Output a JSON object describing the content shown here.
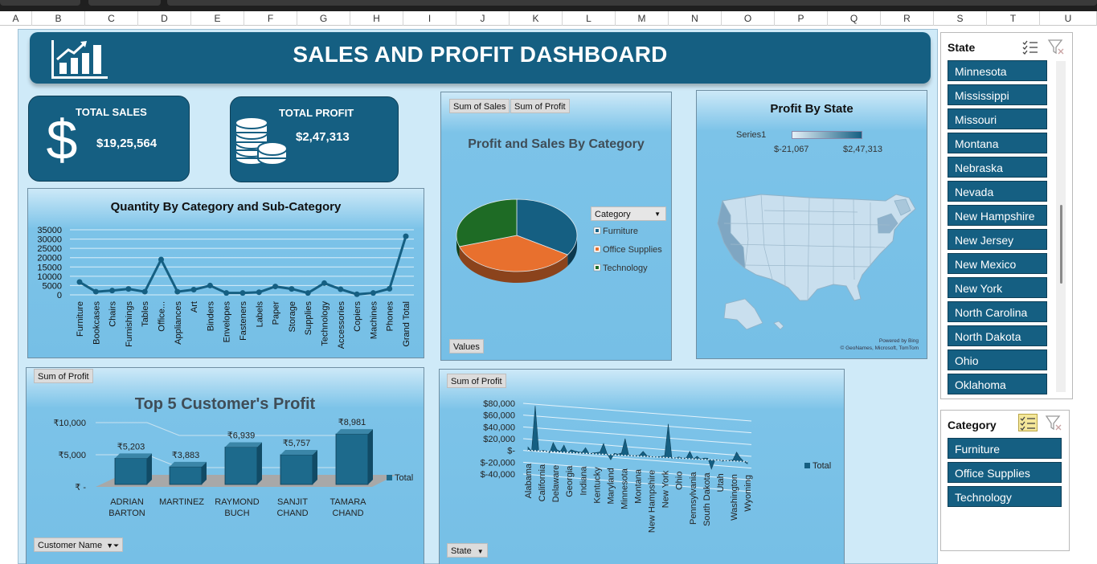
{
  "columns": [
    "A",
    "B",
    "C",
    "D",
    "E",
    "F",
    "G",
    "H",
    "I",
    "J",
    "K",
    "L",
    "M",
    "N",
    "O",
    "P",
    "Q",
    "R",
    "S",
    "T",
    "U"
  ],
  "dashboard": {
    "title": "SALES AND PROFIT DASHBOARD"
  },
  "kpis": {
    "sales": {
      "label": "TOTAL SALES",
      "value": "$19,25,564"
    },
    "profit": {
      "label": "TOTAL PROFIT",
      "value": "$2,47,313"
    }
  },
  "colors": {
    "brand": "#155f82",
    "panel": "#76bfe6",
    "orange": "#e8702e",
    "green": "#1e6b25",
    "line": "#155f82"
  },
  "chart_data": [
    {
      "id": "quantity",
      "type": "line",
      "title": "Quantity By Category and Sub-Category",
      "categories": [
        "Furniture",
        "Bookcases",
        "Chairs",
        "Furnishings",
        "Tables",
        "Office...",
        "Appliances",
        "Art",
        "Binders",
        "Envelopes",
        "Fasteners",
        "Labels",
        "Paper",
        "Storage",
        "Supplies",
        "Technology",
        "Accessories",
        "Copiers",
        "Machines",
        "Phones",
        "Grand Total"
      ],
      "values": [
        6900,
        1700,
        2300,
        3200,
        1700,
        19000,
        1700,
        2800,
        5000,
        1000,
        1000,
        1400,
        4500,
        3200,
        1000,
        6300,
        3000,
        300,
        1000,
        3300,
        31500
      ],
      "yticks": [
        "35000",
        "30000",
        "25000",
        "20000",
        "15000",
        "10000",
        "5000",
        "0"
      ],
      "ylim": [
        0,
        35000
      ]
    },
    {
      "id": "category_pie",
      "type": "pie",
      "title": "Profit and Sales By Category",
      "field_buttons": [
        "Sum of Sales",
        "Sum of Profit"
      ],
      "values_button": "Values",
      "legend_header": "Category",
      "slices": [
        {
          "name": "Furniture",
          "value": 34,
          "color": "#155f82"
        },
        {
          "name": "Office Supplies",
          "value": 36,
          "color": "#e8702e"
        },
        {
          "name": "Technology",
          "value": 30,
          "color": "#1e6b25"
        }
      ]
    },
    {
      "id": "profit_state_map",
      "type": "heatmap",
      "title": "Profit By State",
      "series_label": "Series1",
      "range_min": "$-21,067",
      "range_max": "$2,47,313",
      "attribution_1": "Powered by Bing",
      "attribution_2": "© GeoNames, Microsoft, TomTom"
    },
    {
      "id": "top_customers",
      "type": "bar",
      "title": "Top 5 Customer's Profit",
      "field_button": "Sum of Profit",
      "filter_button": "Customer Name",
      "legend": "Total",
      "categories": [
        [
          "ADRIAN",
          "BARTON"
        ],
        [
          "MARTINEZ",
          ""
        ],
        [
          "RAYMOND",
          "BUCH"
        ],
        [
          "SANJIT",
          "CHAND"
        ],
        [
          "TAMARA",
          "CHAND"
        ]
      ],
      "values": [
        5203,
        3883,
        6939,
        5757,
        8981
      ],
      "labels": [
        "₹5,203",
        "₹3,883",
        "₹6,939",
        "₹5,757",
        "₹8,981"
      ],
      "yticks": [
        "₹10,000",
        "₹5,000",
        "₹ -"
      ],
      "ylim": [
        0,
        10000
      ]
    },
    {
      "id": "state_profit_area",
      "type": "area",
      "field_button": "Sum of Profit",
      "filter_button": "State",
      "legend": "Total",
      "yticks": [
        "$80,000",
        "$60,000",
        "$40,000",
        "$20,000",
        "$-",
        "$-20,000",
        "$-40,000"
      ],
      "ylim": [
        -40000,
        80000
      ],
      "x_labels": [
        "Alabama",
        "California",
        "Delaware",
        "Georgia",
        "Indiana",
        "Kentucky",
        "Maryland",
        "Minnesota",
        "Montana",
        "New Hampshire",
        "New York",
        "Ohio",
        "Pennsylvania",
        "South Dakota",
        "Utah",
        "Washington",
        "Wyoming"
      ],
      "values": [
        5800,
        -1200,
        76400,
        -400,
        1200,
        900,
        -2100,
        15500,
        3900,
        1200,
        12200,
        -800,
        4900,
        3100,
        2000,
        1400,
        9700,
        -400,
        1300,
        2300,
        3600,
        18400,
        1000,
        -8700,
        2700,
        1500,
        3800,
        28500,
        1000,
        400,
        700,
        1400,
        8500,
        1700,
        500,
        100,
        500,
        1400,
        3200,
        57200,
        -1100,
        600,
        2100,
        300,
        1200,
        12500,
        -200,
        4900,
        300,
        2400,
        2600,
        -15600,
        300,
        700,
        -1300,
        -200,
        900,
        2200,
        15300,
        6100,
        100,
        -3600
      ]
    }
  ],
  "slicer_state": {
    "header": "State",
    "items": [
      "Minnesota",
      "Mississippi",
      "Missouri",
      "Montana",
      "Nebraska",
      "Nevada",
      "New Hampshire",
      "New Jersey",
      "New Mexico",
      "New York",
      "North Carolina",
      "North Dakota",
      "Ohio",
      "Oklahoma"
    ]
  },
  "slicer_category": {
    "header": "Category",
    "items": [
      "Furniture",
      "Office Supplies",
      "Technology"
    ]
  }
}
